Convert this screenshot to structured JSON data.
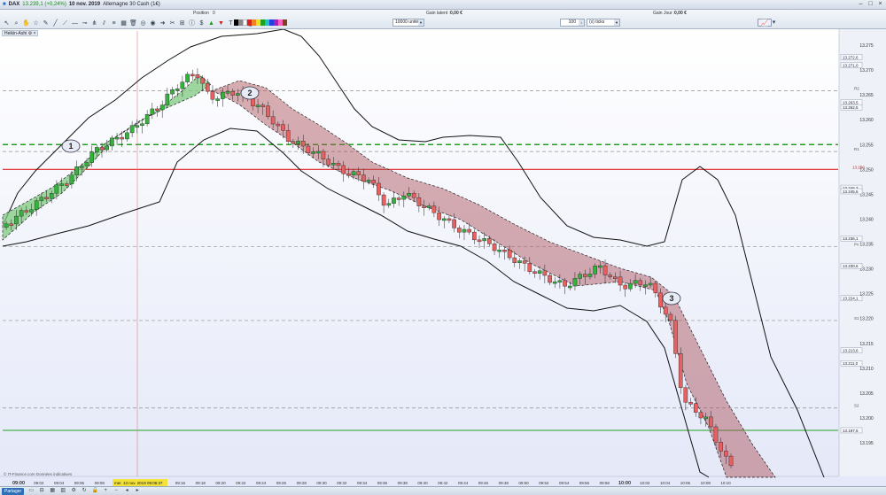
{
  "titlebar": {
    "symbol": "DAX",
    "quote": "13.239,1 (+0,24%)",
    "date": "10 nov. 2019",
    "instrument": "Allemagne 30 Cash (1€)"
  },
  "toolbar": {
    "position_label": "Position",
    "position_value": "0",
    "gain_latent_label": "Gain latent :",
    "gain_latent_value": "0,00 €",
    "gain_jour_label": "Gain Jour :",
    "gain_jour_value": "0,00 €",
    "units_value": "10000 unités",
    "ticks_value": "100",
    "ticks_unit": "(x) ticks"
  },
  "chart": {
    "label": "Heikin-Ashi",
    "watermark": "© IT-Finance.com  Données indicatives",
    "annotations": [
      "1",
      "2",
      "3"
    ],
    "crosshair_date": "mer. 13 nov. 2019 09:06:37",
    "colors": {
      "bull": "#33b33c",
      "bear": "#e86060",
      "bull_fill": "#7fc97f",
      "bear_fill": "#a84b55",
      "support": "#22a022",
      "resistance": "#e02020",
      "band": "#111111"
    },
    "time_labels": [
      "09:00",
      "09:02",
      "09:04",
      "09:06",
      "09:08",
      "09:10",
      "09:12",
      "09:14",
      "09:16",
      "09:18",
      "09:20",
      "09:22",
      "09:24",
      "09:26",
      "09:28",
      "09:30",
      "09:32",
      "09:34",
      "09:36",
      "09:38",
      "09:40",
      "09:42",
      "09:44",
      "09:46",
      "09:48",
      "09:50",
      "09:52",
      "09:54",
      "09:56",
      "09:58",
      "10:00",
      "10:02",
      "10:04",
      "10:06",
      "10:08",
      "10:10"
    ],
    "price_labels": [
      "13.275",
      "13.270",
      "13.265",
      "13.260",
      "13.255",
      "13.250",
      "13.245",
      "13.240",
      "13.235",
      "13.230",
      "13.225",
      "13.220",
      "13.215",
      "13.210",
      "13.205",
      "13.200",
      "13.195"
    ],
    "level_labels": {
      "r2": "R2",
      "r1": "R1",
      "pivot": "Pv",
      "s1": "S1",
      "s2": "S2",
      "res_value": "13.250"
    },
    "price_tags": [
      "13.272,6",
      "13.271,0",
      "13.263,5",
      "13.262,5",
      "13.246,3",
      "13.245,6",
      "13.236,1",
      "13.230,6",
      "13.224,1",
      "13.213,6",
      "13.211,0",
      "13.197,5"
    ]
  },
  "statusbar": {
    "share_label": "Partager"
  }
}
